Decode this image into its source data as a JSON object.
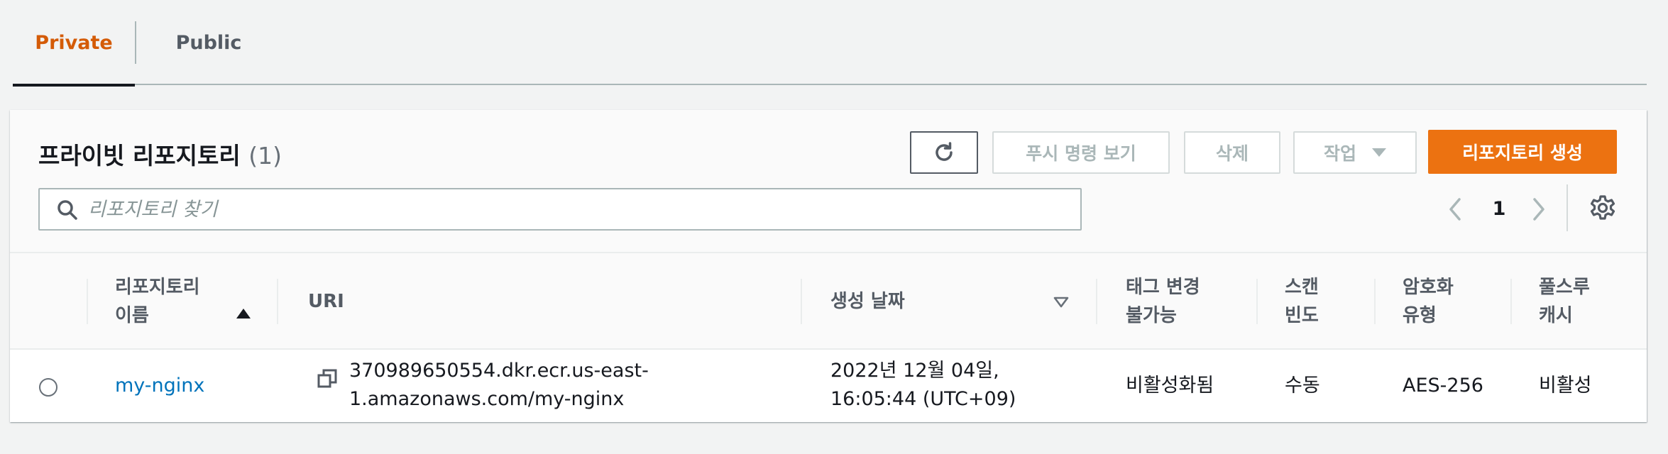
{
  "tabs": [
    {
      "label": "Private"
    },
    {
      "label": "Public"
    }
  ],
  "panel": {
    "title": "프라이빗 리포지토리",
    "count": "(1)"
  },
  "toolbar": {
    "refresh_icon": "refresh-icon",
    "push_commands_label": "푸시 명령 보기",
    "delete_label": "삭제",
    "actions_label": "작업",
    "create_label": "리포지토리 생성"
  },
  "search": {
    "placeholder": "리포지토리 찾기",
    "value": ""
  },
  "pagination": {
    "current_page": "1"
  },
  "table": {
    "columns": [
      {
        "label_line1": "리포지토리",
        "label_line2": "이름"
      },
      {
        "label_line1": "URI",
        "label_line2": ""
      },
      {
        "label_line1": "생성 날짜",
        "label_line2": ""
      },
      {
        "label_line1": "태그 변경",
        "label_line2": "불가능"
      },
      {
        "label_line1": "스캔",
        "label_line2": "빈도"
      },
      {
        "label_line1": "암호화",
        "label_line2": "유형"
      },
      {
        "label_line1": "풀스루",
        "label_line2": "캐시"
      }
    ],
    "rows": [
      {
        "name": "my-nginx",
        "uri_line1": "370989650554.dkr.ecr.us-east-",
        "uri_line2": "1.amazonaws.com/my-nginx",
        "created_line1": "2022년 12월 04일,",
        "created_line2": "16:05:44 (UTC+09)",
        "tag_immutability": "비활성화됨",
        "scan_frequency": "수동",
        "encryption": "AES-256",
        "pull_through_cache": "비활성"
      }
    ]
  },
  "colors": {
    "accent_orange": "#ec7211",
    "active_tab": "#d45b07",
    "link_blue": "#0073bb"
  }
}
